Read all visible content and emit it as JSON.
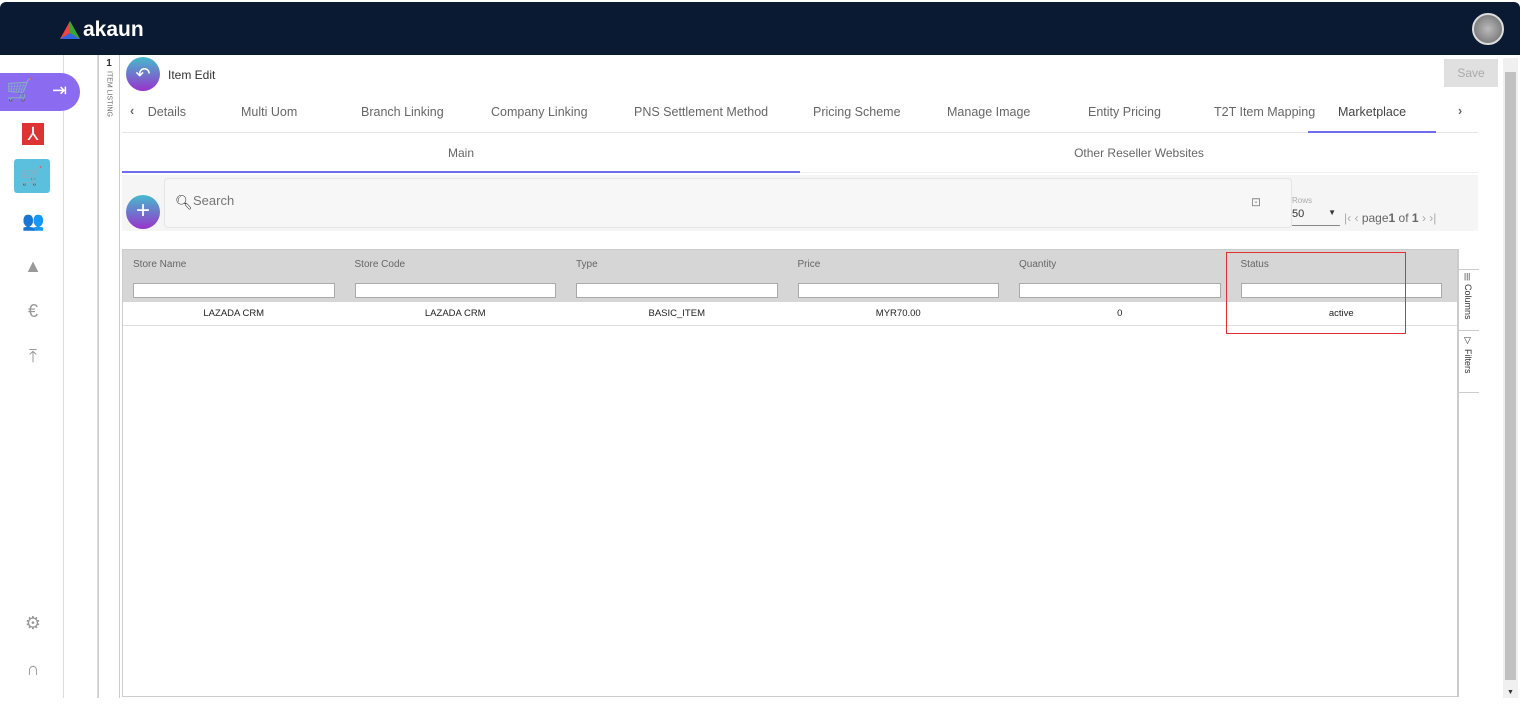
{
  "brand": "akaun",
  "header": {
    "title": "Item Edit",
    "save": "Save"
  },
  "strip": {
    "count": "1",
    "label": "ITEM LISTING"
  },
  "tabs": [
    "Details",
    "Multi Uom",
    "Branch Linking",
    "Company Linking",
    "PNS Settlement Method",
    "Pricing Scheme",
    "Manage Image",
    "Entity Pricing",
    "T2T Item Mapping",
    "Marketplace"
  ],
  "subtabs": [
    "Main",
    "Other Reseller Websites"
  ],
  "search": {
    "placeholder": "Search"
  },
  "pager": {
    "rows_label": "Rows",
    "rows": "50",
    "page_label": "page",
    "page": "1",
    "of": "of",
    "total": "1"
  },
  "table": {
    "columns": [
      "Store Name",
      "Store Code",
      "Type",
      "Price",
      "Quantity",
      "Status"
    ],
    "rows": [
      [
        "LAZADA CRM",
        "LAZADA CRM",
        "BASIC_ITEM",
        "MYR70.00",
        "0",
        "active"
      ]
    ]
  },
  "side_panel": {
    "columns": "Columns",
    "filters": "Filters"
  },
  "colors": {
    "navy": "#0b1a33",
    "accent": "#6f6cf0",
    "highlight": "#e03030"
  }
}
